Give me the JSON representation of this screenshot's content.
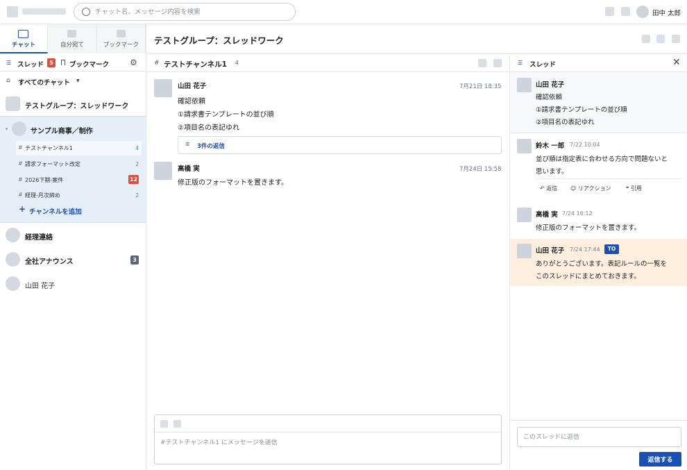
{
  "search": {
    "placeholder": "チャット名、メッセージ内容を検索"
  },
  "topbar": {
    "user_name": "田中 太郎"
  },
  "nav_tabs": [
    {
      "label": "チャット",
      "active": true
    },
    {
      "label": "自分宛て",
      "active": false
    },
    {
      "label": "ブックマーク",
      "active": false
    }
  ],
  "left_subheader": {
    "threads_label": "スレッド",
    "threads_badge": "5",
    "bookmarks_label": "ブックマーク"
  },
  "all_chats": {
    "label": "すべてのチャット"
  },
  "chats": {
    "first": {
      "name": "テストグループ：スレッドワーク"
    },
    "group": {
      "name": "サンプル商事／制作",
      "channels": [
        {
          "name": "テストチャンネル1",
          "count": "4"
        },
        {
          "name": "請求フォーマット改定",
          "count": "2"
        },
        {
          "name": "2026下期-案件",
          "badge": "12"
        },
        {
          "name": "経理-月次締め",
          "count": "2"
        }
      ],
      "add_channel_label": "チャンネルを追加"
    },
    "others": [
      {
        "name": "経理連絡"
      },
      {
        "name": "全社アナウンス",
        "badge": "3"
      },
      {
        "name": "山田 花子"
      }
    ]
  },
  "header": {
    "title": "テストグループ：スレッドワーク"
  },
  "channel": {
    "name": "テストチャンネル1",
    "member_count": "4",
    "messages": [
      {
        "author": "山田 花子",
        "time": "7月21日 18:35",
        "lines": [
          "確認依頼",
          "①請求書テンプレートの並び順",
          "②項目名の表記ゆれ"
        ],
        "reply_label": "3件の返信"
      },
      {
        "author": "高橋 実",
        "time": "7月24日 15:58",
        "lines": [
          "修正版のフォーマットを置きます。"
        ]
      }
    ],
    "composer_placeholder": "#テストチャンネル1 にメッセージを送信"
  },
  "thread": {
    "title": "スレッド",
    "root": {
      "author": "山田 花子",
      "lines": [
        "確認依頼",
        "①請求書テンプレートの並び順",
        "②項目名の表記ゆれ"
      ]
    },
    "replies": [
      {
        "author": "鈴木 一郎",
        "time": "7/22 10:04",
        "lines": [
          "並び順は指定表に合わせる方向で問題ないと",
          "思います。"
        ]
      },
      {
        "author": "高橋 実",
        "time": "7/24 16:12",
        "lines": [
          "修正版のフォーマットを置きます。"
        ]
      },
      {
        "author": "山田 花子",
        "time": "7/24 17:44",
        "badge": "TO",
        "lines": [
          "ありがとうございます。表記ルールの一覧を",
          "このスレッドにまとめておきます。"
        ]
      }
    ],
    "actions": {
      "reply": "返信",
      "reaction": "リアクション",
      "quote": "引用"
    },
    "input_placeholder": "このスレッドに返信",
    "send_label": "返信する"
  }
}
